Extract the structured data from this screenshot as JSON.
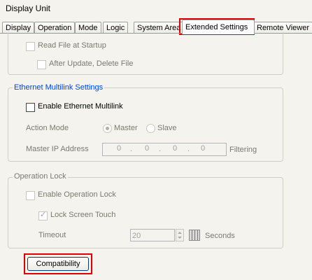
{
  "window": {
    "title": "Display Unit"
  },
  "tabs": [
    {
      "label": "Display"
    },
    {
      "label": "Operation"
    },
    {
      "label": "Mode"
    },
    {
      "label": "Logic"
    },
    {
      "label": "System Area"
    },
    {
      "label": "Extended Settings",
      "active": true
    },
    {
      "label": "Remote Viewer"
    }
  ],
  "file_section": {
    "read_file_at_startup": {
      "label": "Read File at Startup",
      "checked": false,
      "enabled": false
    },
    "after_update_delete": {
      "label": "After Update, Delete File",
      "checked": false,
      "enabled": false
    }
  },
  "ethernet_multilink": {
    "group_title": "Ethernet Multilink Settings",
    "enable": {
      "label": "Enable Ethernet Multilink",
      "checked": false,
      "enabled": true
    },
    "action_mode": {
      "label": "Action Mode",
      "options": [
        "Master",
        "Slave"
      ],
      "selected": "Master"
    },
    "master_ip": {
      "label": "Master IP Address",
      "octets": [
        "0",
        "0",
        "0",
        "0"
      ],
      "filtering_label": "Filtering"
    }
  },
  "operation_lock": {
    "group_title": "Operation Lock",
    "enable": {
      "label": "Enable Operation Lock",
      "checked": false,
      "enabled": false
    },
    "lock_screen_touch": {
      "label": "Lock Screen Touch",
      "checked": true,
      "enabled": false
    },
    "timeout": {
      "label": "Timeout",
      "value": "20",
      "unit": "Seconds"
    }
  },
  "buttons": {
    "compatibility": "Compatibility"
  },
  "colors": {
    "highlight": "#e00000",
    "dialog_bg": "#f4f3ee",
    "group_title": "#0046d5"
  }
}
